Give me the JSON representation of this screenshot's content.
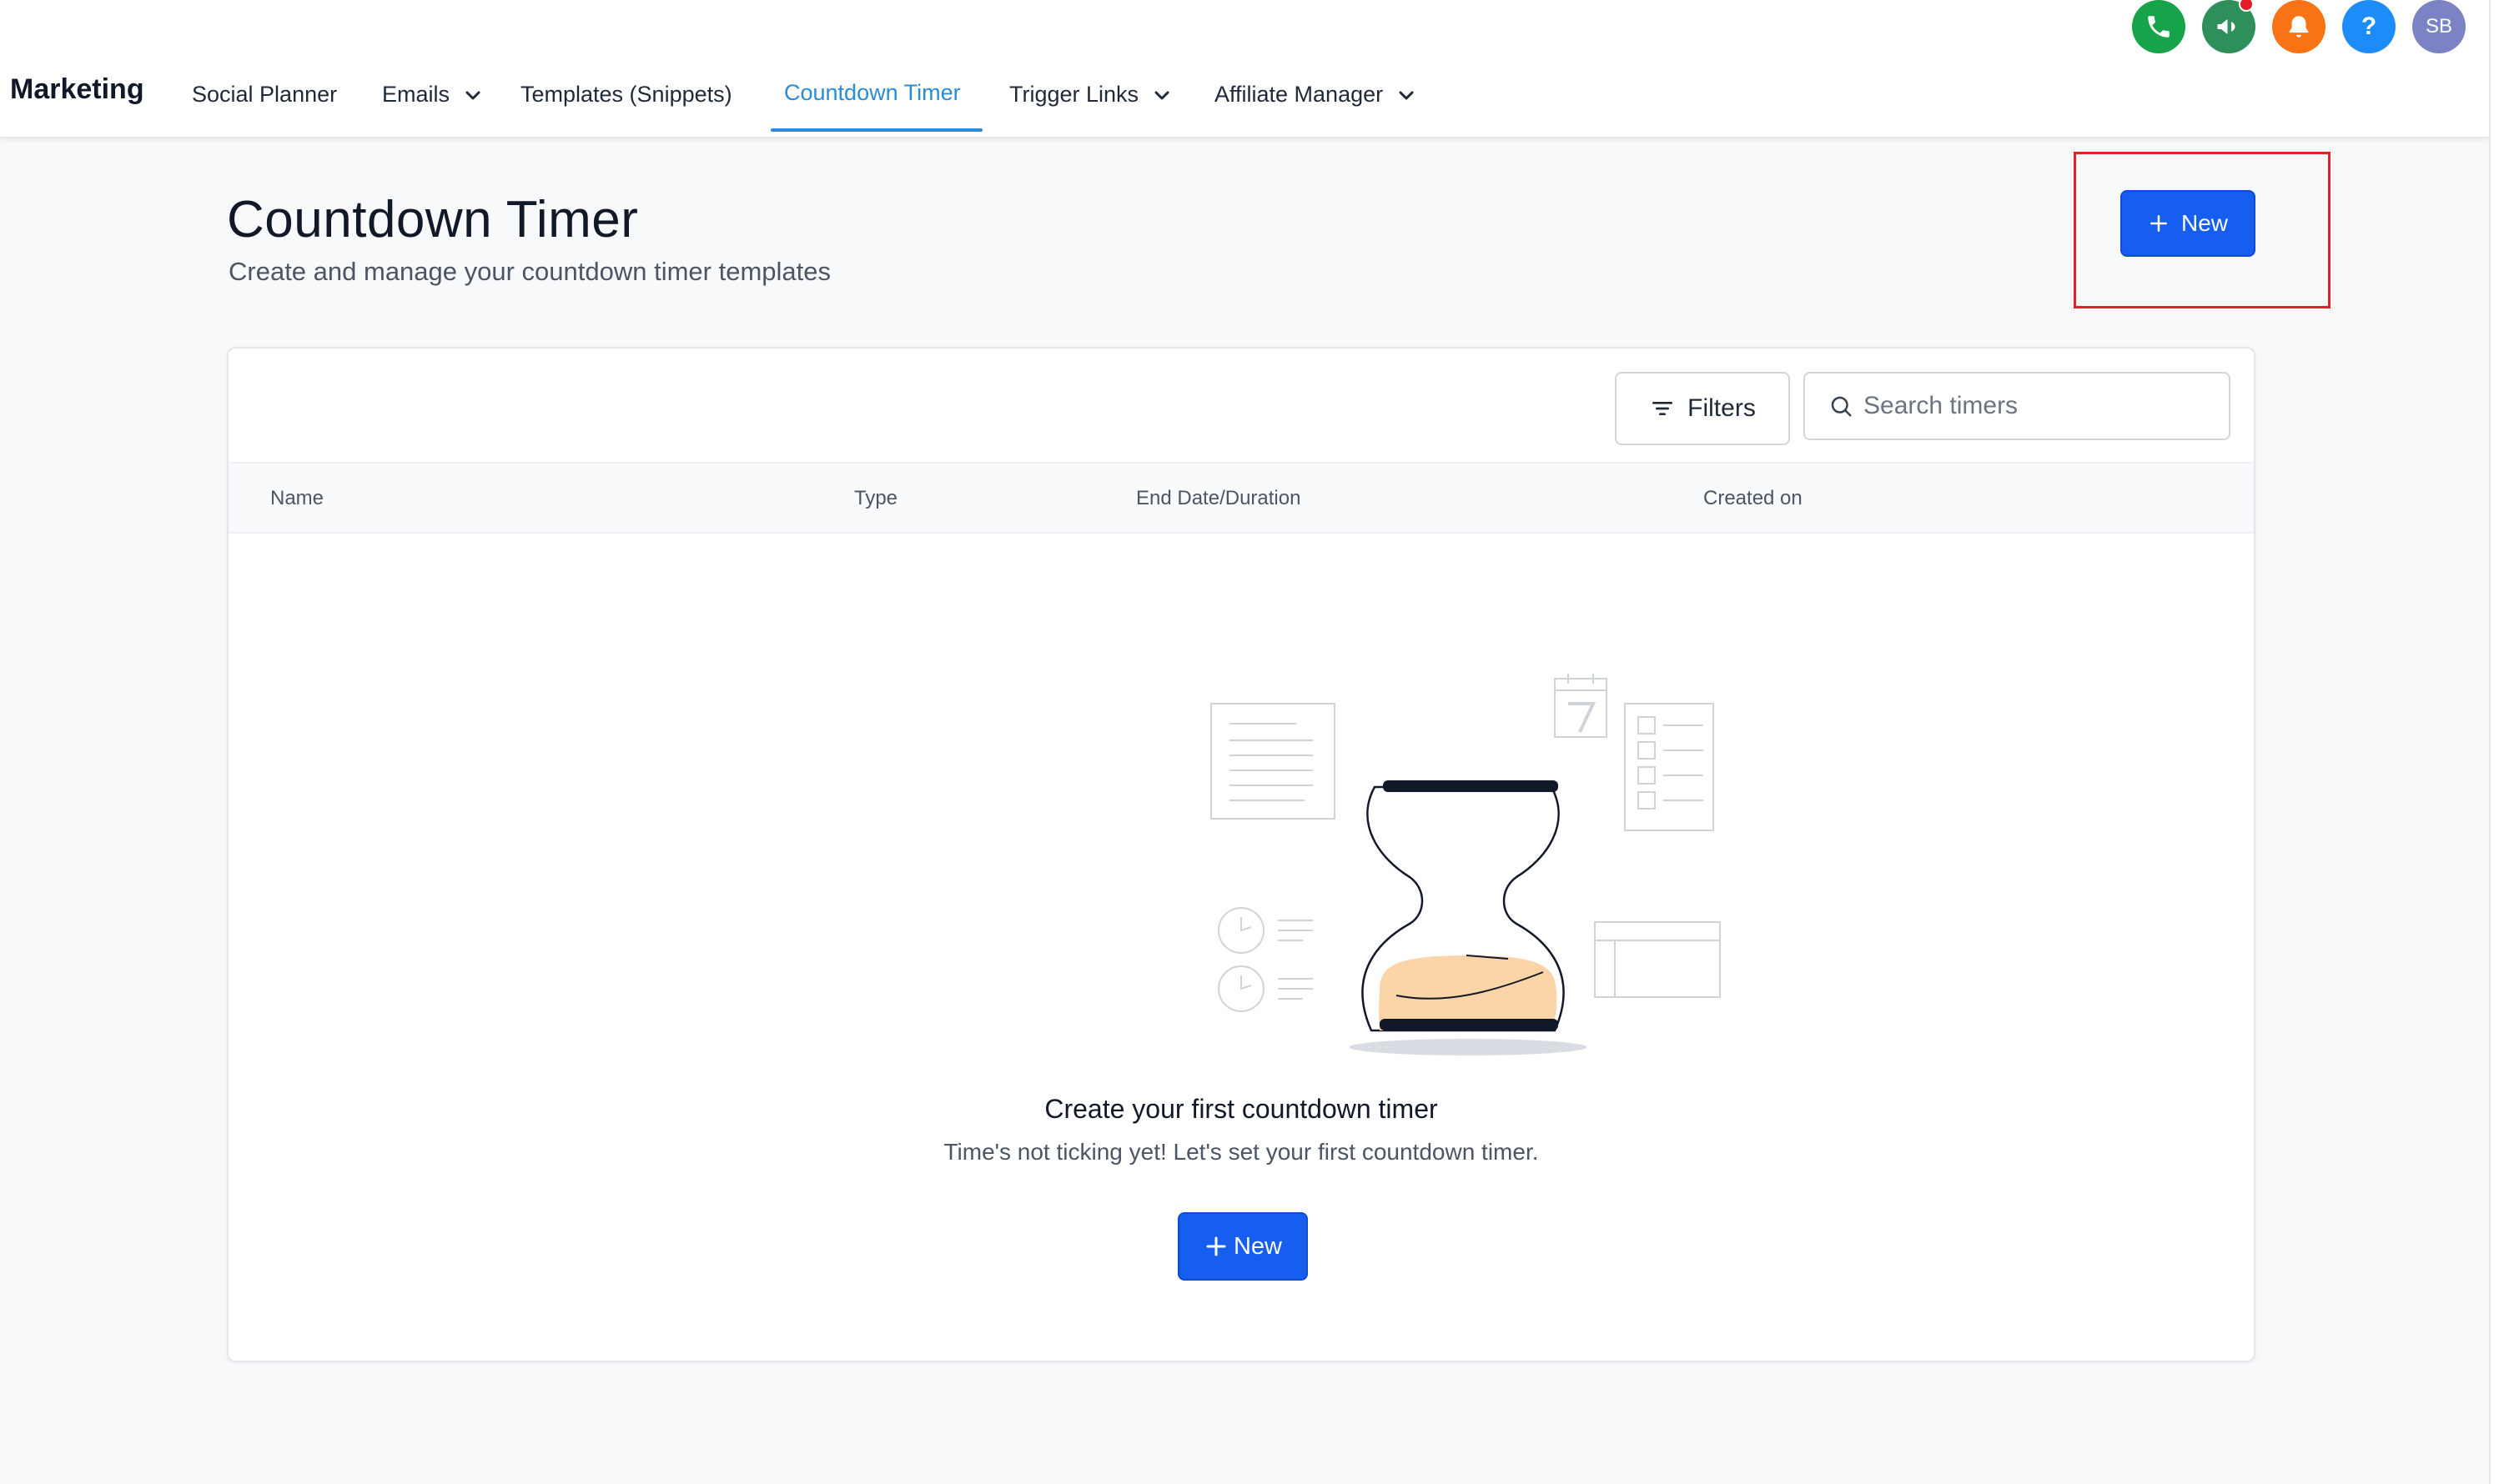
{
  "header": {
    "brand": "Marketing",
    "nav": [
      {
        "label": "Social Planner",
        "dropdown": false,
        "active": false
      },
      {
        "label": "Emails",
        "dropdown": true,
        "active": false
      },
      {
        "label": "Templates (Snippets)",
        "dropdown": false,
        "active": false
      },
      {
        "label": "Countdown Timer",
        "dropdown": false,
        "active": true
      },
      {
        "label": "Trigger Links",
        "dropdown": true,
        "active": false
      },
      {
        "label": "Affiliate Manager",
        "dropdown": true,
        "active": false
      }
    ],
    "icons": [
      {
        "name": "phone-icon",
        "color": "#16a34a"
      },
      {
        "name": "megaphone-icon",
        "color": "#2f8f5b",
        "badge": true
      },
      {
        "name": "bell-icon",
        "color": "#f97316"
      },
      {
        "name": "help-icon",
        "color": "#1d8cf8",
        "glyph": "?"
      },
      {
        "name": "avatar",
        "color": "#7c83c4",
        "initials": "SB"
      }
    ]
  },
  "page": {
    "title": "Countdown Timer",
    "subtitle": "Create and manage your countdown timer templates",
    "new_label": "New"
  },
  "toolbar": {
    "filters_label": "Filters",
    "search_placeholder": "Search timers"
  },
  "table": {
    "columns": [
      "Name",
      "Type",
      "End Date/Duration",
      "Created on"
    ]
  },
  "empty_state": {
    "title": "Create your first countdown timer",
    "subtitle": "Time's not ticking yet! Let's set your first countdown timer.",
    "new_label": "New"
  },
  "colors": {
    "primary": "#155eef",
    "active_tab": "#2a8bd6",
    "highlight": "#e5202a",
    "sand": "#fbd5a8"
  }
}
